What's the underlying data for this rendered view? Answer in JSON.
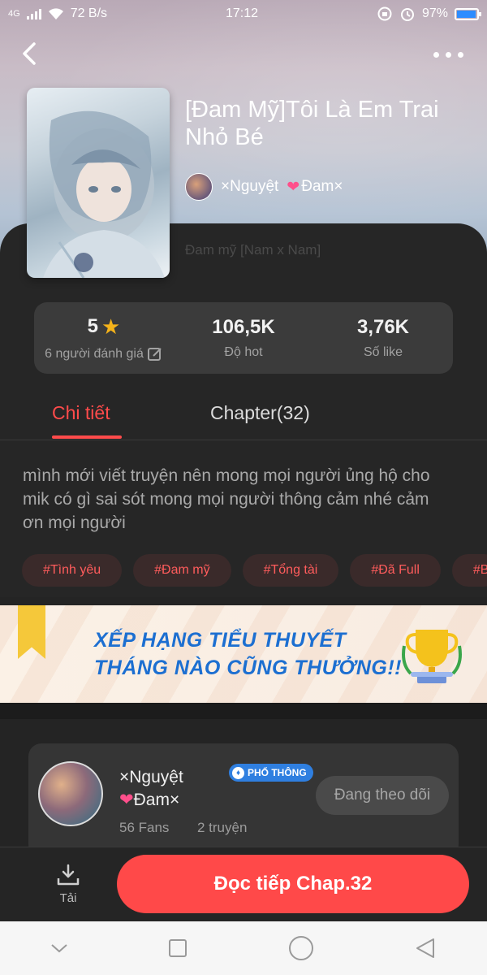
{
  "status_bar": {
    "network": "4G",
    "speed": "72 B/s",
    "time": "17:12",
    "battery": "97%",
    "battery_level": 0.97
  },
  "story": {
    "title": "[Đam Mỹ]Tôi Là Em Trai Nhỏ Bé",
    "author_name": "×Nguyệt",
    "author_suffix": "Đam×",
    "genre": "Đam mỹ [Nam x Nam]"
  },
  "stats": {
    "rating_value": "5",
    "rating_label": "6 người đánh giá",
    "hot_value": "106,5K",
    "hot_label": "Độ hot",
    "likes_value": "3,76K",
    "likes_label": "Số like"
  },
  "tabs": {
    "detail": "Chi tiết",
    "chapters": "Chapter(32)"
  },
  "description": "mình mới viết truyện nên mong mọi người ủng hộ cho mik có gì sai sót mong mọi người thông cảm nhé cảm ơn mọi người",
  "tags": [
    "#Tình yêu",
    "#Đam mỹ",
    "#Tổng tài",
    "#Đã Full",
    "#B"
  ],
  "banner": {
    "line1": "XẾP HẠNG TIỂU THUYẾT",
    "line2": "THÁNG NÀO CŨNG THƯỞNG!!"
  },
  "author_card": {
    "name_line1": "×Nguyệt",
    "name_line2": "Đam×",
    "badge": "PHỔ THÔNG",
    "fans": "56 Fans",
    "stories": "2 truyện",
    "follow_label": "Đang theo dõi"
  },
  "actions": {
    "download_label": "Tải",
    "read_label": "Đọc tiếp Chap.32"
  },
  "colors": {
    "accent": "#ff4949",
    "background": "#242424",
    "badge": "#2f7fe0",
    "star": "#f5b31a"
  }
}
